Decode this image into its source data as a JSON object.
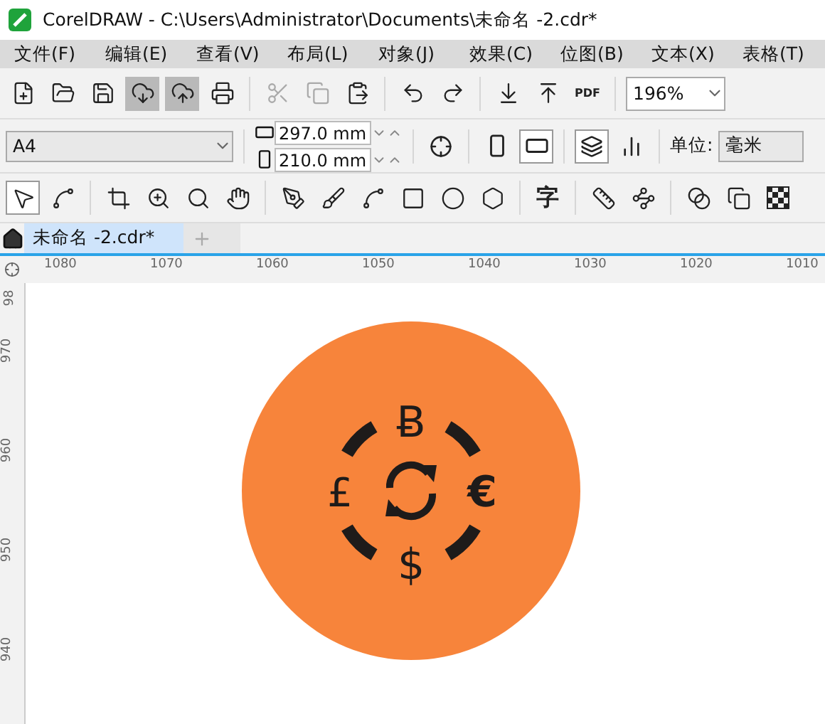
{
  "window": {
    "title": "CorelDRAW - C:\\Users\\Administrator\\Documents\\未命名 -2.cdr*"
  },
  "menu": [
    {
      "label": "文件(F)"
    },
    {
      "label": "编辑(E)"
    },
    {
      "label": "查看(V)"
    },
    {
      "label": "布局(L)"
    },
    {
      "label": "对象(J)"
    },
    {
      "label": "效果(C)"
    },
    {
      "label": "位图(B)"
    },
    {
      "label": "文本(X)"
    },
    {
      "label": "表格(T)"
    }
  ],
  "standard_toolbar": {
    "buttons": [
      {
        "kind": "new",
        "pressed": false,
        "disabled": false
      },
      {
        "kind": "open",
        "pressed": false,
        "disabled": false
      },
      {
        "kind": "save",
        "pressed": false,
        "disabled": false
      },
      {
        "kind": "cloud-down",
        "pressed": true,
        "disabled": false
      },
      {
        "kind": "cloud-up",
        "pressed": true,
        "disabled": false
      },
      {
        "kind": "print",
        "pressed": false,
        "disabled": false
      },
      {
        "kind": "sep"
      },
      {
        "kind": "cut",
        "pressed": false,
        "disabled": true
      },
      {
        "kind": "copy",
        "pressed": false,
        "disabled": true
      },
      {
        "kind": "paste",
        "pressed": false,
        "disabled": false
      },
      {
        "kind": "sep"
      },
      {
        "kind": "undo",
        "pressed": false,
        "disabled": false
      },
      {
        "kind": "redo",
        "pressed": false,
        "disabled": false
      },
      {
        "kind": "sep"
      },
      {
        "kind": "import",
        "pressed": false,
        "disabled": false
      },
      {
        "kind": "export",
        "pressed": false,
        "disabled": false
      },
      {
        "kind": "pdf",
        "label": "PDF",
        "pressed": false,
        "disabled": false
      }
    ],
    "zoom": "196%"
  },
  "property_bar": {
    "page_size": "A4",
    "width": "297.0 mm",
    "height": "210.0 mm",
    "orientation_portrait": {
      "selected": false
    },
    "orientation_landscape": {
      "selected": true
    },
    "unit_label": "单位:",
    "unit": "毫米"
  },
  "toolbox": [
    {
      "kind": "pick",
      "selected": true
    },
    {
      "kind": "shape",
      "selected": false
    },
    {
      "kind": "sep"
    },
    {
      "kind": "crop",
      "selected": false
    },
    {
      "kind": "zoom",
      "selected": false
    },
    {
      "kind": "zoom2",
      "selected": false
    },
    {
      "kind": "pan",
      "selected": false
    },
    {
      "kind": "sep"
    },
    {
      "kind": "pen",
      "selected": false
    },
    {
      "kind": "brush",
      "selected": false
    },
    {
      "kind": "curve",
      "selected": false
    },
    {
      "kind": "rect",
      "selected": false
    },
    {
      "kind": "ellipse",
      "selected": false
    },
    {
      "kind": "polygon",
      "selected": false
    },
    {
      "kind": "sep"
    },
    {
      "kind": "text",
      "label": "字",
      "selected": false
    },
    {
      "kind": "sep"
    },
    {
      "kind": "dimension",
      "selected": false
    },
    {
      "kind": "connector",
      "selected": false
    },
    {
      "kind": "sep"
    },
    {
      "kind": "blend",
      "selected": false
    },
    {
      "kind": "shadow",
      "selected": false
    },
    {
      "kind": "transparency",
      "selected": false
    }
  ],
  "tabs": [
    {
      "label": "未命名 -2.cdr*",
      "selected": true
    }
  ],
  "horizontal_ruler": [
    "1080",
    "1070",
    "1060",
    "1050",
    "1040",
    "1030",
    "1020",
    "1010"
  ],
  "vertical_ruler": [
    "98",
    "970",
    "960",
    "950",
    "940"
  ],
  "artwork": {
    "color": "#f7843b",
    "symbols": [
      "Ƀ",
      "£",
      "€",
      "$"
    ]
  }
}
